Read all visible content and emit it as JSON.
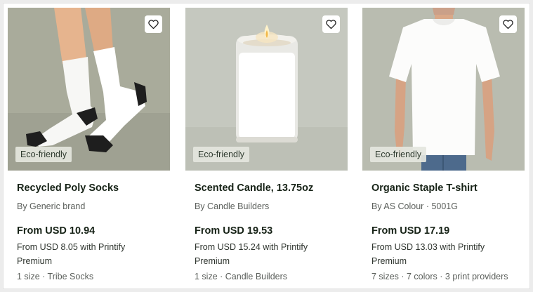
{
  "products": [
    {
      "badge": "Eco-friendly",
      "title": "Recycled Poly Socks",
      "brand": "By Generic brand",
      "price": "From USD 10.94",
      "premium": "From USD 8.05 with Printify Premium",
      "meta": "1 size · Tribe Socks",
      "image_bg": "#a9ab9b",
      "favorite_icon": "heart-outline-icon"
    },
    {
      "badge": "Eco-friendly",
      "title": "Scented Candle, 13.75oz",
      "brand": "By Candle Builders",
      "price": "From USD 19.53",
      "premium": "From USD 15.24 with Printify Premium",
      "meta": "1 size · Candle Builders",
      "image_bg": "#c5c8bf",
      "favorite_icon": "heart-outline-icon"
    },
    {
      "badge": "Eco-friendly",
      "title": "Organic Staple T-shirt",
      "brand": "By AS Colour · 5001G",
      "price": "From USD 17.19",
      "premium": "From USD 13.03 with Printify Premium",
      "meta": "7 sizes · 7 colors · 3 print providers",
      "image_bg": "#b9bcb0",
      "favorite_icon": "heart-outline-icon"
    }
  ]
}
